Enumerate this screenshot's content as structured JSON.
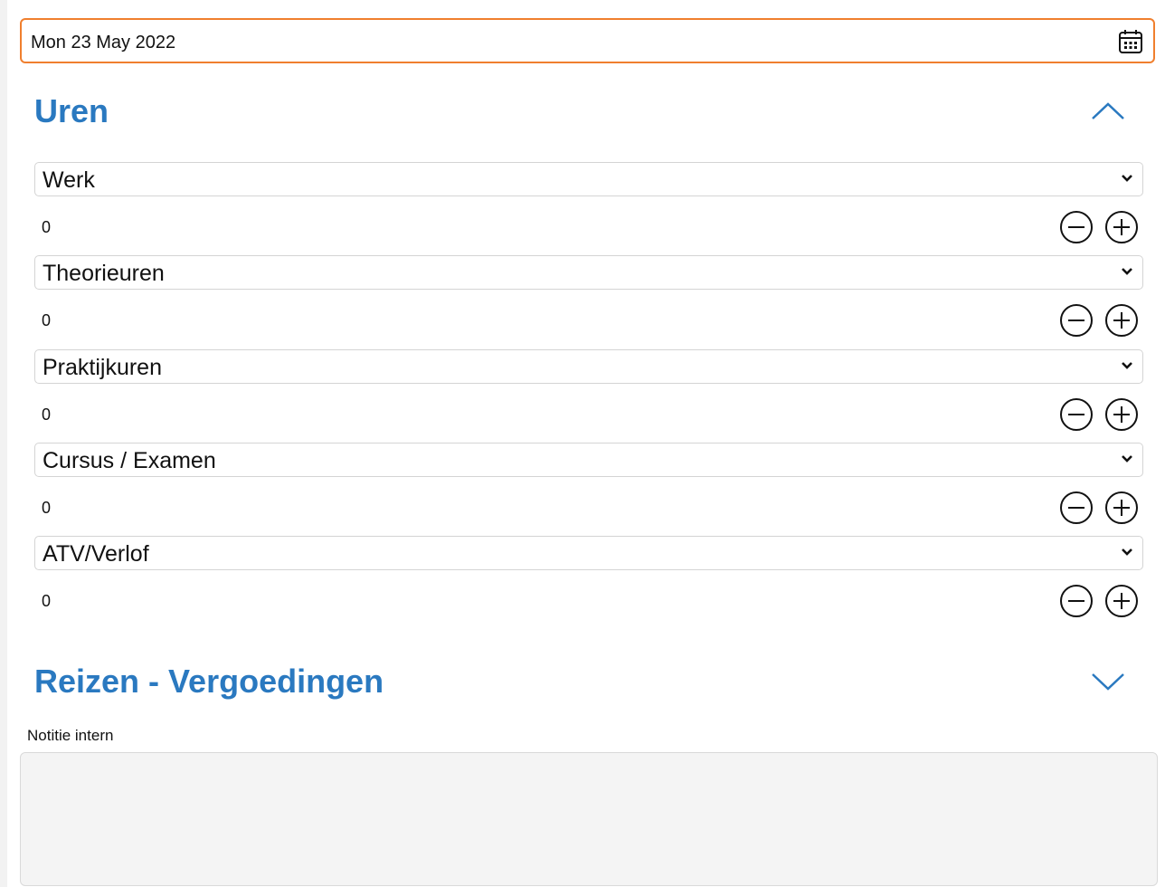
{
  "date_field": {
    "value": "Mon 23 May 2022",
    "icon": "calendar-icon"
  },
  "uren": {
    "title": "Uren",
    "toggle_icon": "chevron-up-icon",
    "rows": [
      {
        "label": "Werk",
        "count": "0"
      },
      {
        "label": "Theorieuren",
        "count": "0"
      },
      {
        "label": "Praktijkuren",
        "count": "0"
      },
      {
        "label": "Cursus / Examen",
        "count": "0"
      },
      {
        "label": "ATV/Verlof",
        "count": "0"
      }
    ]
  },
  "reizen": {
    "title": "Reizen - Vergoedingen",
    "toggle_icon": "chevron-down-icon"
  },
  "notitie": {
    "label": "Notitie intern",
    "value": ""
  },
  "colors": {
    "accent": "#2a79c0",
    "focus_border": "#f07f2e",
    "textarea_bg": "#f4f4f4"
  }
}
